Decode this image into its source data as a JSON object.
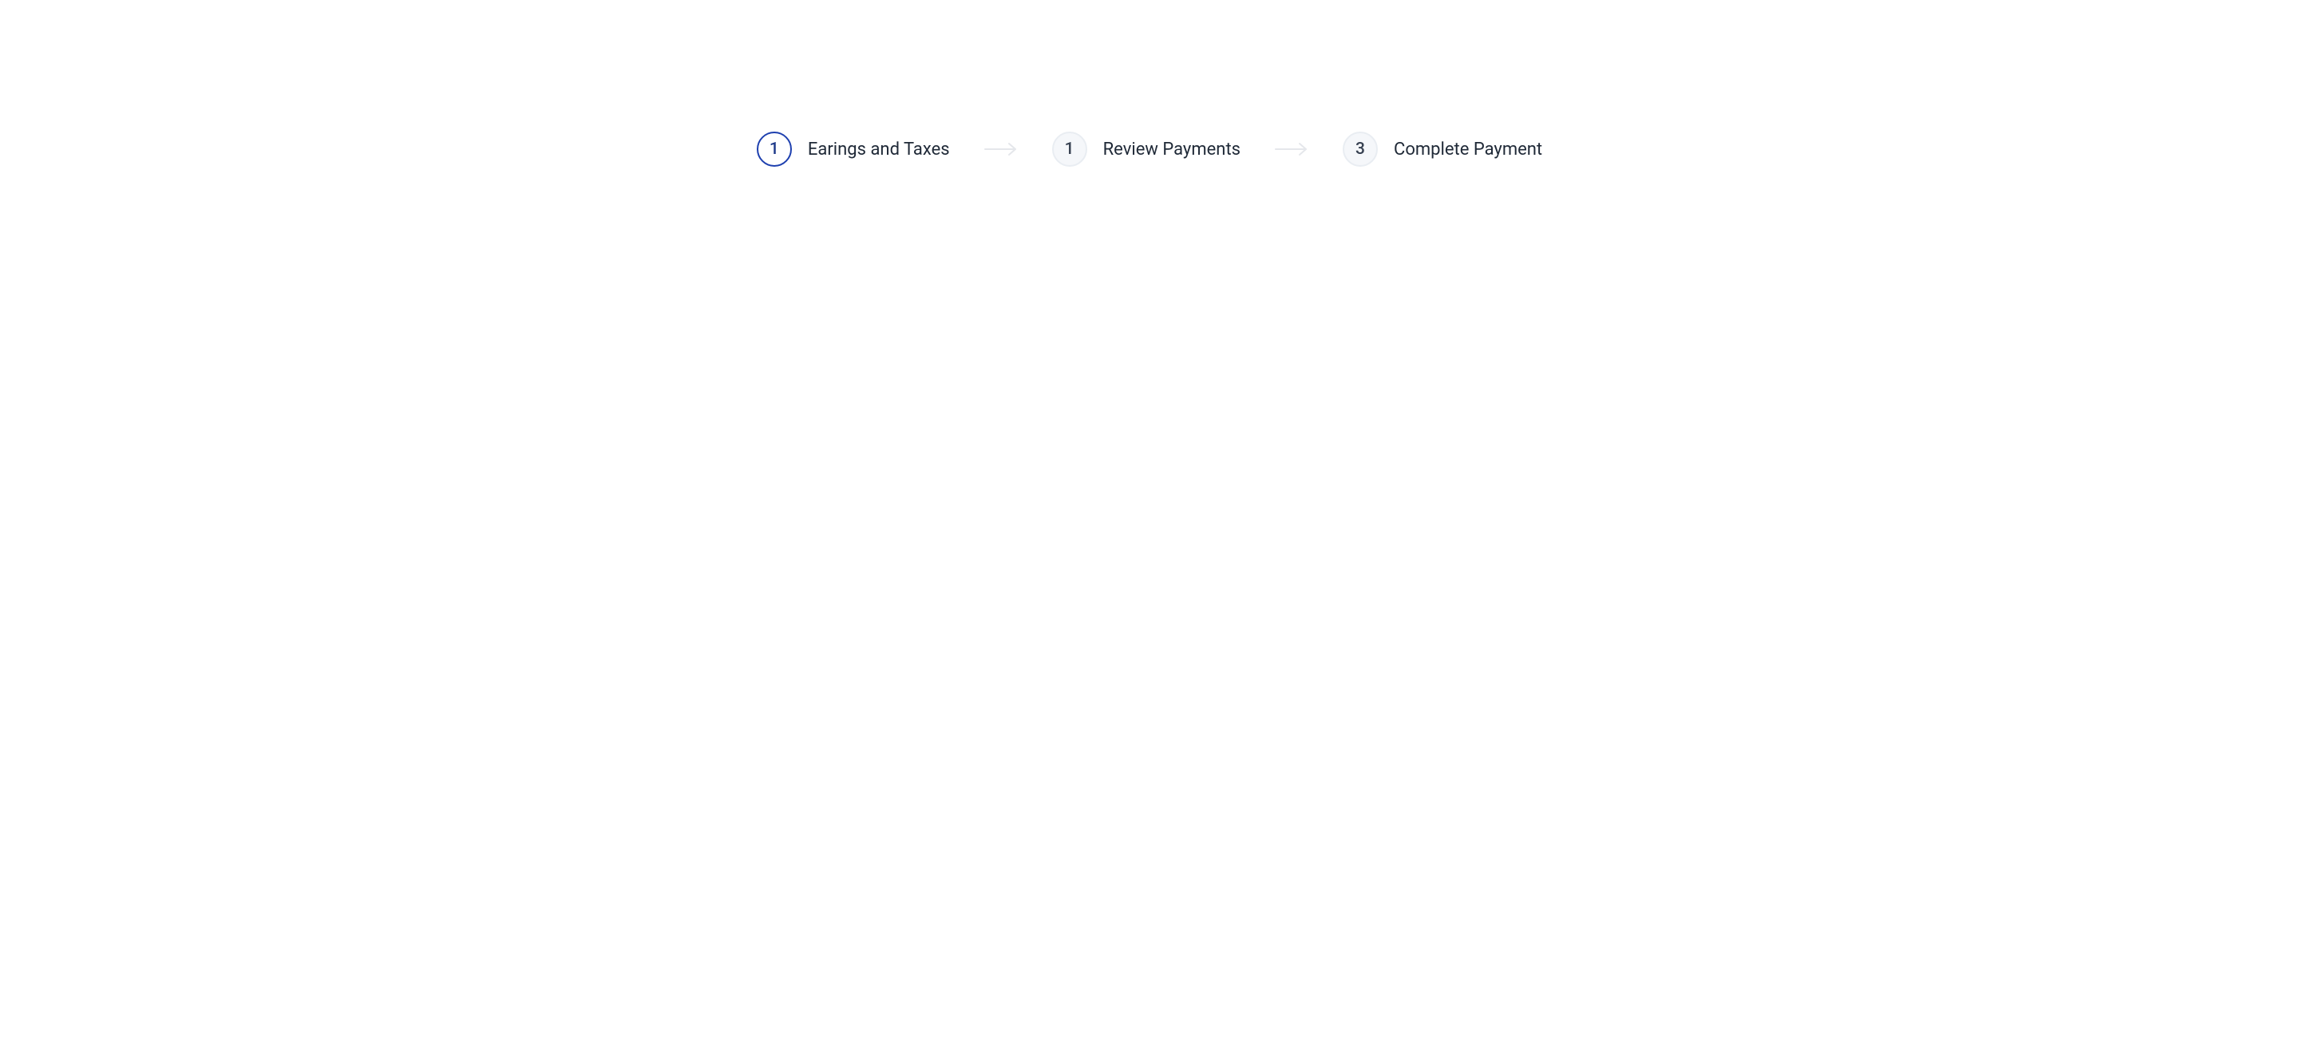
{
  "stepper": {
    "steps": [
      {
        "number": "1",
        "label": "Earings and Taxes",
        "active": true
      },
      {
        "number": "1",
        "label": "Review Payments",
        "active": false
      },
      {
        "number": "3",
        "label": "Complete Payment",
        "active": false
      }
    ]
  },
  "colors": {
    "activeCircleBorder": "#1e40af",
    "inactiveCircleBg": "#f5f7fa",
    "inactiveCircleBorder": "#e9edf2",
    "textPrimary": "#1f2937",
    "arrow": "#e5e7eb"
  }
}
